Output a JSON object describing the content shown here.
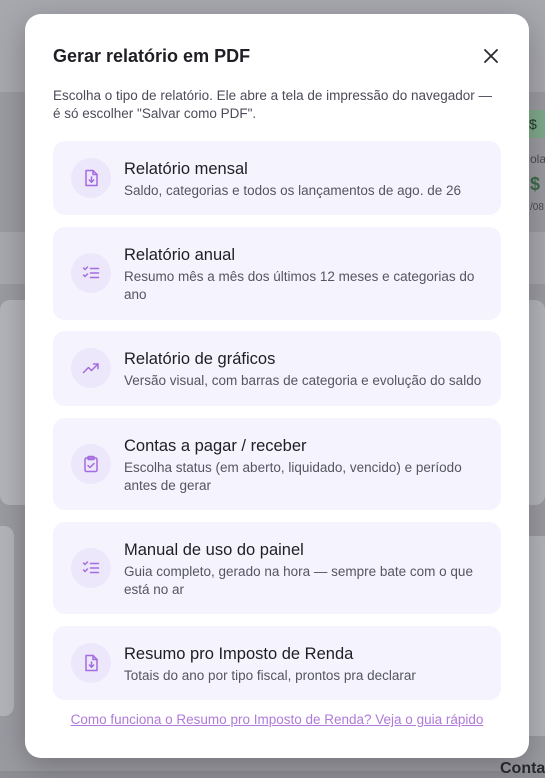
{
  "modal": {
    "title": "Gerar relatório em PDF",
    "description": "Escolha o tipo de relatório. Ele abre a tela de impressão do navegador — é só escolher \"Salvar como PDF\".",
    "close_icon": "close-icon",
    "options": [
      {
        "title": "Relatório mensal",
        "subtitle": "Saldo, categorias e todos os lançamentos de ago. de 26",
        "icon": "file-download-icon"
      },
      {
        "title": "Relatório anual",
        "subtitle": "Resumo mês a mês dos últimos 12 meses e categorias do ano",
        "icon": "checklist-icon"
      },
      {
        "title": "Relatório de gráficos",
        "subtitle": "Versão visual, com barras de categoria e evolução do saldo",
        "icon": "trending-up-icon"
      },
      {
        "title": "Contas a pagar / receber",
        "subtitle": "Escolha status (em aberto, liquidado, vencido) e período antes de gerar",
        "icon": "clipboard-check-icon"
      },
      {
        "title": "Manual de uso do painel",
        "subtitle": "Guia completo, gerado na hora — sempre bate com o que está no ar",
        "icon": "checklist-icon"
      },
      {
        "title": "Resumo pro Imposto de Renda",
        "subtitle": "Totais do ano por tipo fiscal, prontos pra declarar",
        "icon": "file-download-icon"
      }
    ],
    "guide_link": "Como funciona o Resumo pro Imposto de Renda? Veja o guia rápido"
  },
  "background": {
    "badge_text": "$",
    "label_text": "olar",
    "amount_text": "$",
    "date_text": "/08",
    "bottom_text": "Conta"
  },
  "colors": {
    "accent": "#a56be0",
    "option_bg": "#f5f3fd",
    "icon_bg": "#ece7fb"
  }
}
